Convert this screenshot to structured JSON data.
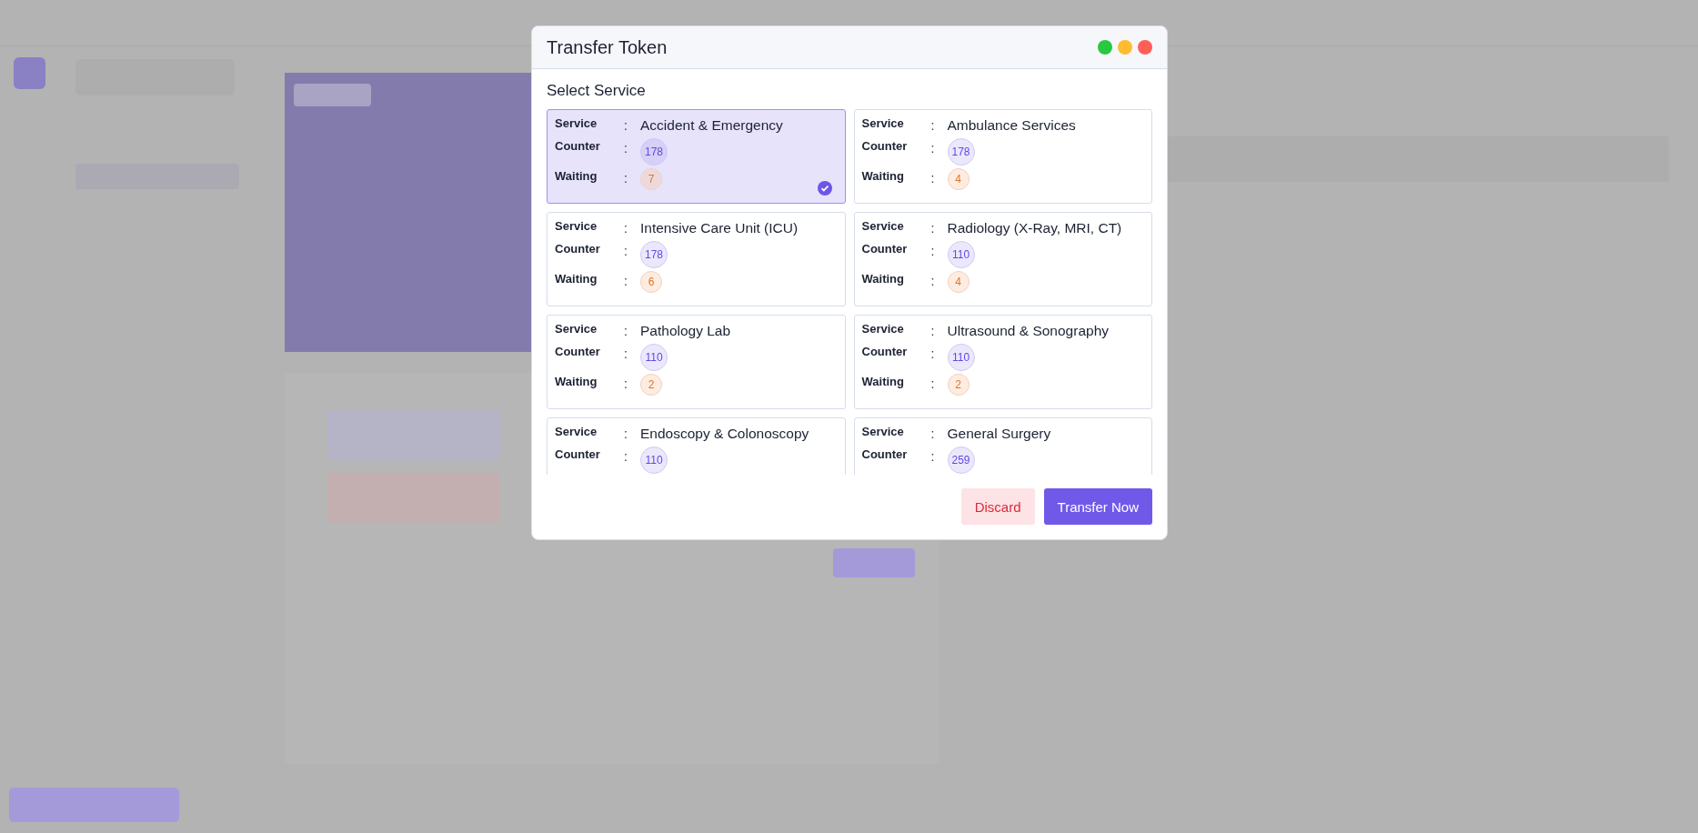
{
  "dialog": {
    "title": "Transfer Token",
    "window_controls": [
      {
        "color": "#28c840"
      },
      {
        "color": "#febc2e"
      },
      {
        "color": "#ff5f57"
      }
    ],
    "section_title": "Select Service",
    "services": [
      {
        "selected": true,
        "fields": [
          {
            "kind": "text",
            "label": "Service",
            "colon": ":",
            "value": "Accident & Emergency"
          },
          {
            "kind": "counter",
            "label": "Counter",
            "colon": ":",
            "value": "178"
          },
          {
            "kind": "waiting",
            "label": "Waiting",
            "colon": ":",
            "value": "7"
          }
        ]
      },
      {
        "selected": false,
        "fields": [
          {
            "kind": "text",
            "label": "Service",
            "colon": ":",
            "value": "Ambulance Services"
          },
          {
            "kind": "counter",
            "label": "Counter",
            "colon": ":",
            "value": "178"
          },
          {
            "kind": "waiting",
            "label": "Waiting",
            "colon": ":",
            "value": "4"
          }
        ]
      },
      {
        "selected": false,
        "fields": [
          {
            "kind": "text",
            "label": "Service",
            "colon": ":",
            "value": "Intensive Care Unit (ICU)"
          },
          {
            "kind": "counter",
            "label": "Counter",
            "colon": ":",
            "value": "178"
          },
          {
            "kind": "waiting",
            "label": "Waiting",
            "colon": ":",
            "value": "6"
          }
        ]
      },
      {
        "selected": false,
        "fields": [
          {
            "kind": "text",
            "label": "Service",
            "colon": ":",
            "value": "Radiology (X-Ray, MRI, CT)"
          },
          {
            "kind": "counter",
            "label": "Counter",
            "colon": ":",
            "value": "110"
          },
          {
            "kind": "waiting",
            "label": "Waiting",
            "colon": ":",
            "value": "4"
          }
        ]
      },
      {
        "selected": false,
        "fields": [
          {
            "kind": "text",
            "label": "Service",
            "colon": ":",
            "value": "Pathology Lab"
          },
          {
            "kind": "counter",
            "label": "Counter",
            "colon": ":",
            "value": "110"
          },
          {
            "kind": "waiting",
            "label": "Waiting",
            "colon": ":",
            "value": "2"
          }
        ]
      },
      {
        "selected": false,
        "fields": [
          {
            "kind": "text",
            "label": "Service",
            "colon": ":",
            "value": "Ultrasound & Sonography"
          },
          {
            "kind": "counter",
            "label": "Counter",
            "colon": ":",
            "value": "110"
          },
          {
            "kind": "waiting",
            "label": "Waiting",
            "colon": ":",
            "value": "2"
          }
        ]
      },
      {
        "selected": false,
        "fields": [
          {
            "kind": "text",
            "label": "Service",
            "colon": ":",
            "value": "Endoscopy & Colonoscopy"
          },
          {
            "kind": "counter",
            "label": "Counter",
            "colon": ":",
            "value": "110"
          }
        ]
      },
      {
        "selected": false,
        "fields": [
          {
            "kind": "text",
            "label": "Service",
            "colon": ":",
            "value": "General Surgery"
          },
          {
            "kind": "counter",
            "label": "Counter",
            "colon": ":",
            "value": "259"
          }
        ]
      }
    ],
    "buttons": [
      {
        "label": "Discard",
        "kind": "secondary"
      },
      {
        "label": "Transfer Now",
        "kind": "primary"
      }
    ]
  }
}
